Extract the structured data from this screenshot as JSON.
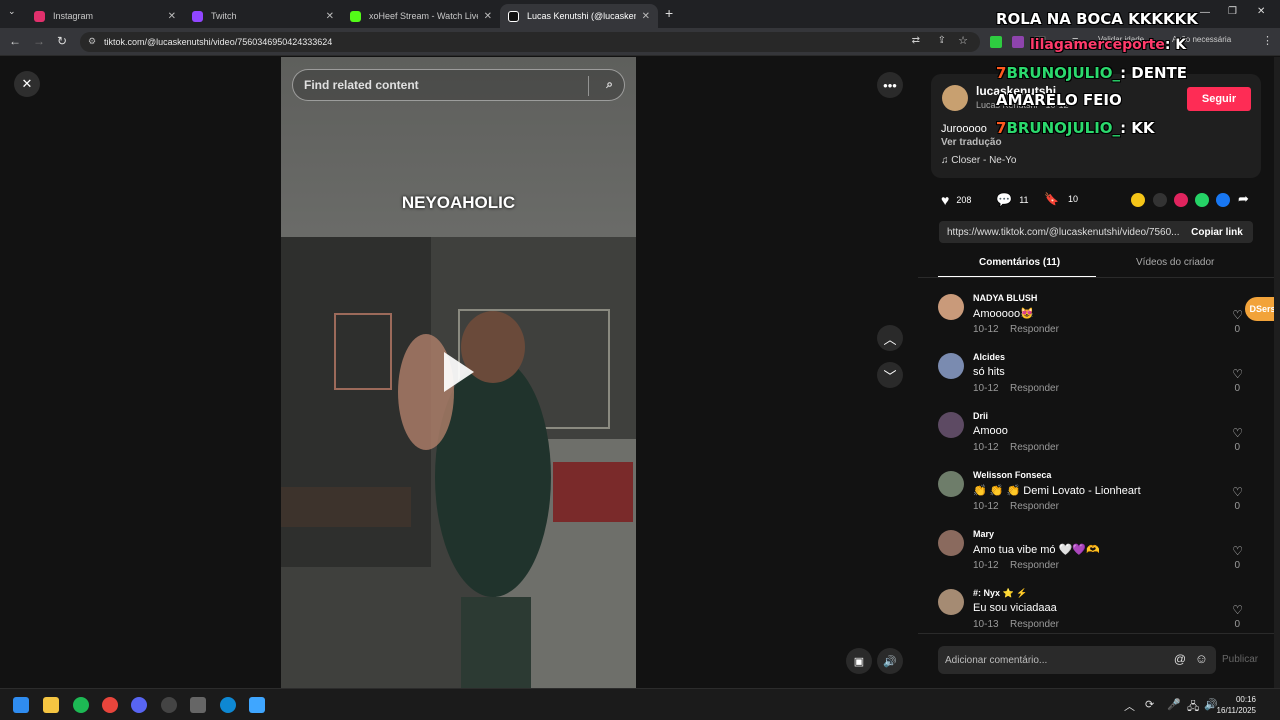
{
  "browser": {
    "tabs": [
      {
        "title": "Instagram",
        "color": "#e1306c"
      },
      {
        "title": "Twitch",
        "color": "#9146ff"
      },
      {
        "title": "xoHeef Stream - Watch Live on",
        "color": "#53fc18"
      },
      {
        "title": "Lucas Kenutshi (@lucaskenutsh",
        "color": "#ffffff"
      }
    ],
    "url": "tiktok.com/@lucaskenutshi/video/7560346950424333624",
    "ext_validate": "Validar idade",
    "ext_validate_tail": "ade",
    "ext_action": "Ação necessária"
  },
  "video": {
    "search_placeholder": "Find related content",
    "overlay_text": "NEYOAHOLIC"
  },
  "author": {
    "username": "lucaskenutshi",
    "subtitle": "Lucas Kenutshi · 10-12",
    "follow_label": "Seguir",
    "caption": "Jurooooo",
    "translate_label": "Ver tradução",
    "music": "Closer - Ne-Yo"
  },
  "stats": {
    "likes": "208",
    "comments": "11",
    "saves": "10"
  },
  "share": {
    "link": "https://www.tiktok.com/@lucaskenutshi/video/7560...",
    "copy_label": "Copiar link"
  },
  "tabs": {
    "comments": "Comentários (11)",
    "creator_videos": "Vídeos do criador"
  },
  "comments": [
    {
      "name": "NADYA BLUSH",
      "text": "Amooooo😻",
      "date": "10-12",
      "reply": "Responder",
      "likes": "0",
      "avatar_color": "#c99a7a"
    },
    {
      "name": "Alcides",
      "text": "só hits",
      "date": "10-12",
      "reply": "Responder",
      "likes": "0",
      "avatar_color": "#7a8bb0"
    },
    {
      "name": "Drii",
      "text": "Amooo",
      "date": "10-12",
      "reply": "Responder",
      "likes": "0",
      "avatar_color": "#5d4a63"
    },
    {
      "name": "Welisson Fonseca",
      "text": "👏 👏 👏 Demi Lovato - Lionheart",
      "date": "10-12",
      "reply": "Responder",
      "likes": "0",
      "avatar_color": "#6e7d6a"
    },
    {
      "name": "Mary",
      "text": "Amo tua vibe mó 🤍💜🫶",
      "date": "10-12",
      "reply": "Responder",
      "likes": "0",
      "avatar_color": "#8a6a5e"
    },
    {
      "name": "#: Nyx ⭐ ⚡",
      "text": "Eu sou viciadaaa",
      "date": "10-13",
      "reply": "Responder",
      "likes": "0",
      "avatar_color": "#a58b73"
    }
  ],
  "composer": {
    "placeholder": "Adicionar comentário...",
    "publish_label": "Publicar"
  },
  "dsers_label": "DSers",
  "overlay": {
    "line1": "ROLA NA BOCA KKKKKK",
    "line2_user": "BRUNOJULIO_",
    "line2_text": ": DENTE",
    "line3": "AMARELO FEIO",
    "line4_user": "BRUNOJULIO_",
    "line4_text": ": KK",
    "line0_user": "lilagamerceporte",
    "line0_text": ": K"
  },
  "taskbar": {
    "time": "00:16",
    "date": "16/11/2025"
  }
}
